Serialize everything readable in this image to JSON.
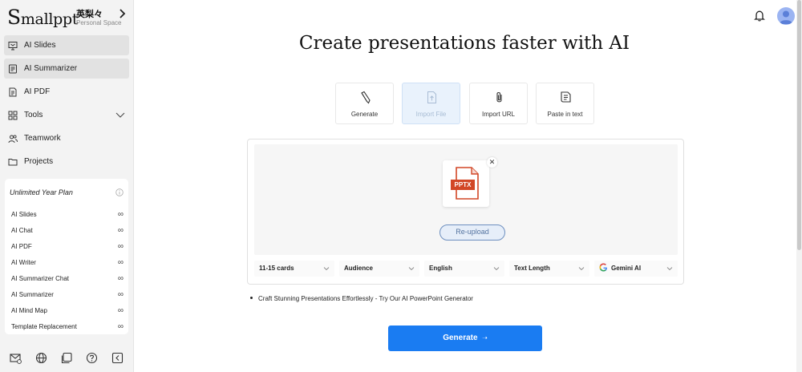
{
  "brand": {
    "logo_initial": "S",
    "logo_rest": "mallppt",
    "workspace_name": "英梨々",
    "workspace_sub": "Personal Space"
  },
  "nav": [
    {
      "label": "AI Slides",
      "icon": "slides-icon",
      "selected": true
    },
    {
      "label": "AI Summarizer",
      "icon": "summarizer-icon",
      "selected": true
    },
    {
      "label": "AI PDF",
      "icon": "pdf-icon",
      "selected": false
    },
    {
      "label": "Tools",
      "icon": "tools-icon",
      "selected": false,
      "has_caret": true
    },
    {
      "label": "Teamwork",
      "icon": "team-icon",
      "selected": false
    },
    {
      "label": "Projects",
      "icon": "folder-icon",
      "selected": false
    }
  ],
  "plan": {
    "title": "Unlimited Year Plan",
    "items": [
      {
        "label": "AI Slides",
        "value": "∞"
      },
      {
        "label": "AI Chat",
        "value": "∞"
      },
      {
        "label": "AI PDF",
        "value": "∞"
      },
      {
        "label": "AI Writer",
        "value": "∞"
      },
      {
        "label": "AI Summarizer Chat",
        "value": "∞"
      },
      {
        "label": "AI Summarizer",
        "value": "∞"
      },
      {
        "label": "AI Mind Map",
        "value": "∞"
      },
      {
        "label": "Template Replacement",
        "value": "∞"
      }
    ]
  },
  "main": {
    "title": "Create presentations faster with AI",
    "modes": [
      {
        "label": "Generate",
        "icon": "pencil-icon",
        "active": false
      },
      {
        "label": "Import File",
        "icon": "file-icon",
        "active": true
      },
      {
        "label": "Import URL",
        "icon": "paperclip-icon",
        "active": false
      },
      {
        "label": "Paste in text",
        "icon": "paste-text-icon",
        "active": false
      }
    ],
    "file_badge": "PPTX",
    "close_glyph": "✕",
    "reupload_label": "Re-upload",
    "options": [
      {
        "label": "11-15 cards"
      },
      {
        "label": "Audience"
      },
      {
        "label": "English"
      },
      {
        "label": "Text Length"
      },
      {
        "label": "Gemini AI"
      }
    ],
    "tip": "Craft Stunning Presentations Effortlessly - Try Our AI PowerPoint Generator",
    "generate_label": "Generate",
    "generate_arrow": "➝"
  },
  "colors": {
    "primary": "#1a7cf2",
    "pptx_orange": "#d24726",
    "sidebar_bg": "#f3f3f3"
  }
}
